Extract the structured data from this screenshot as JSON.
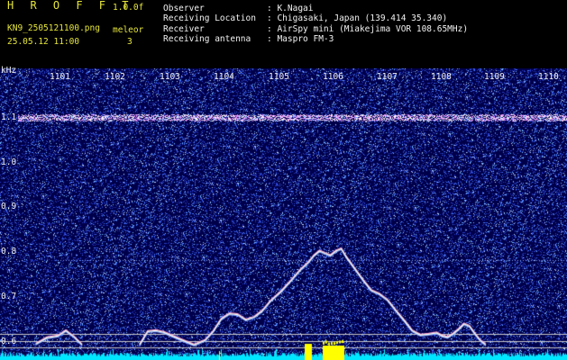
{
  "header": {
    "logo": "H R O F F T",
    "version": "1.0.0f",
    "filename": "KN9_2505121100.png",
    "datetime": "25.05.12 11:00",
    "mode_label": "meleor",
    "mode_value": "3",
    "info": [
      {
        "label": "Observer",
        "value": ": K.Nagai"
      },
      {
        "label": "Receiving Location",
        "value": ": Chigasaki, Japan (139.414 35.340)"
      },
      {
        "label": "Receiver",
        "value": ": AirSpy mini (Miakejima VOR 108.65MHz)"
      },
      {
        "label": "Receiving antenna",
        "value": ": Maspro FM-3"
      }
    ]
  },
  "colors": {
    "background": "#00004a",
    "spectrum": "#00e6ff",
    "signal": "#ffff00",
    "text": "#f2f2f2"
  },
  "chart_data": {
    "type": "line",
    "ylabel": "kHz",
    "x_ticks": [
      "1101",
      "1102",
      "1103",
      "1104",
      "1105",
      "1106",
      "1107",
      "1108",
      "1109",
      "1110"
    ],
    "y_ticks": [
      "1.1",
      "1.0",
      "0.9",
      "0.8",
      "0.7",
      "0.6"
    ],
    "ylim": [
      0.58,
      1.16
    ],
    "series": [
      {
        "x": [
          1100.6,
          1100.8,
          1101.0,
          1101.15,
          1101.3,
          1101.45,
          1102.5,
          1102.65,
          1102.8,
          1102.95,
          1103.1,
          1103.3,
          1103.5,
          1103.7,
          1103.85,
          1104.0,
          1104.15,
          1104.3,
          1104.45,
          1104.6,
          1104.75,
          1104.9,
          1105.1,
          1105.3,
          1105.45,
          1105.6,
          1105.7,
          1105.8,
          1105.9,
          1106.0,
          1106.1,
          1106.2,
          1106.3,
          1106.45,
          1106.6,
          1106.75,
          1106.9,
          1107.05,
          1107.2,
          1107.35,
          1107.5,
          1107.65,
          1107.8,
          1107.95,
          1108.05,
          1108.15,
          1108.25,
          1108.35,
          1108.45,
          1108.55,
          1108.65,
          1108.75,
          1108.85
        ],
        "y": [
          0.592,
          0.606,
          0.61,
          0.622,
          0.608,
          0.59,
          0.59,
          0.62,
          0.622,
          0.618,
          0.61,
          0.6,
          0.59,
          0.6,
          0.62,
          0.648,
          0.66,
          0.658,
          0.646,
          0.652,
          0.666,
          0.688,
          0.71,
          0.737,
          0.758,
          0.775,
          0.79,
          0.8,
          0.795,
          0.79,
          0.8,
          0.805,
          0.785,
          0.76,
          0.735,
          0.712,
          0.704,
          0.69,
          0.667,
          0.645,
          0.622,
          0.612,
          0.614,
          0.617,
          0.61,
          0.607,
          0.615,
          0.625,
          0.637,
          0.632,
          0.615,
          0.6,
          0.59
        ]
      }
    ]
  }
}
